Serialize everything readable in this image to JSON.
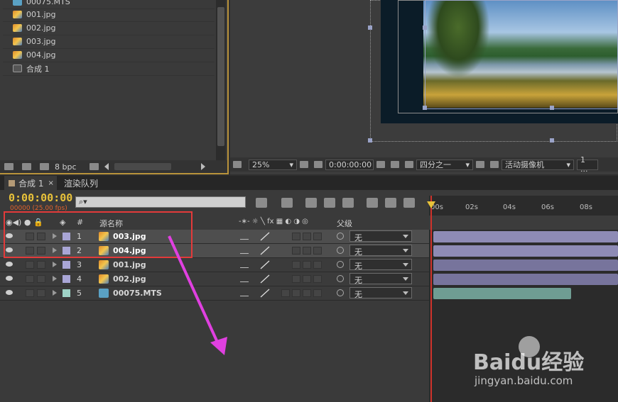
{
  "project": {
    "items": [
      {
        "name": "00075.MTS",
        "type": "mts"
      },
      {
        "name": "001.jpg",
        "type": "jpg"
      },
      {
        "name": "002.jpg",
        "type": "jpg"
      },
      {
        "name": "003.jpg",
        "type": "jpg"
      },
      {
        "name": "004.jpg",
        "type": "jpg"
      },
      {
        "name": "合成 1",
        "type": "comp"
      }
    ],
    "bit_depth": "8 bpc"
  },
  "viewer": {
    "zoom": "25%",
    "timecode": "0:00:00:00",
    "resolution": "四分之一",
    "camera": "活动摄像机",
    "views": "1 ..."
  },
  "tabs": {
    "composition": "合成 1",
    "render_queue": "渲染队列"
  },
  "timeline": {
    "timecode": "0:00:00:00",
    "fps": "00000 (25.00 fps)",
    "search_placeholder": "",
    "ruler_labels": [
      "00s",
      "02s",
      "04s",
      "06s",
      "08s"
    ],
    "header": {
      "number": "#",
      "source_name": "源名称",
      "parent": "父级"
    },
    "layers": [
      {
        "index": "1",
        "name": "003.jpg",
        "selected": true,
        "label_color": "#a9a6d6",
        "parent": "无"
      },
      {
        "index": "2",
        "name": "004.jpg",
        "selected": true,
        "label_color": "#a9a6d6",
        "parent": "无"
      },
      {
        "index": "3",
        "name": "001.jpg",
        "selected": false,
        "label_color": "#a9a6d6",
        "parent": "无"
      },
      {
        "index": "4",
        "name": "002.jpg",
        "selected": false,
        "label_color": "#a9a6d6",
        "parent": "无"
      },
      {
        "index": "5",
        "name": "00075.MTS",
        "selected": false,
        "label_color": "#9fd3c7",
        "parent": "无"
      }
    ]
  },
  "watermark": {
    "brand": "Baidu经验",
    "url": "jingyan.baidu.com"
  },
  "colors": {
    "accent_timecode": "#e8c23a",
    "annotation": "#e33a3a",
    "arrow": "#e040e0",
    "playhead": "#d0322b"
  }
}
